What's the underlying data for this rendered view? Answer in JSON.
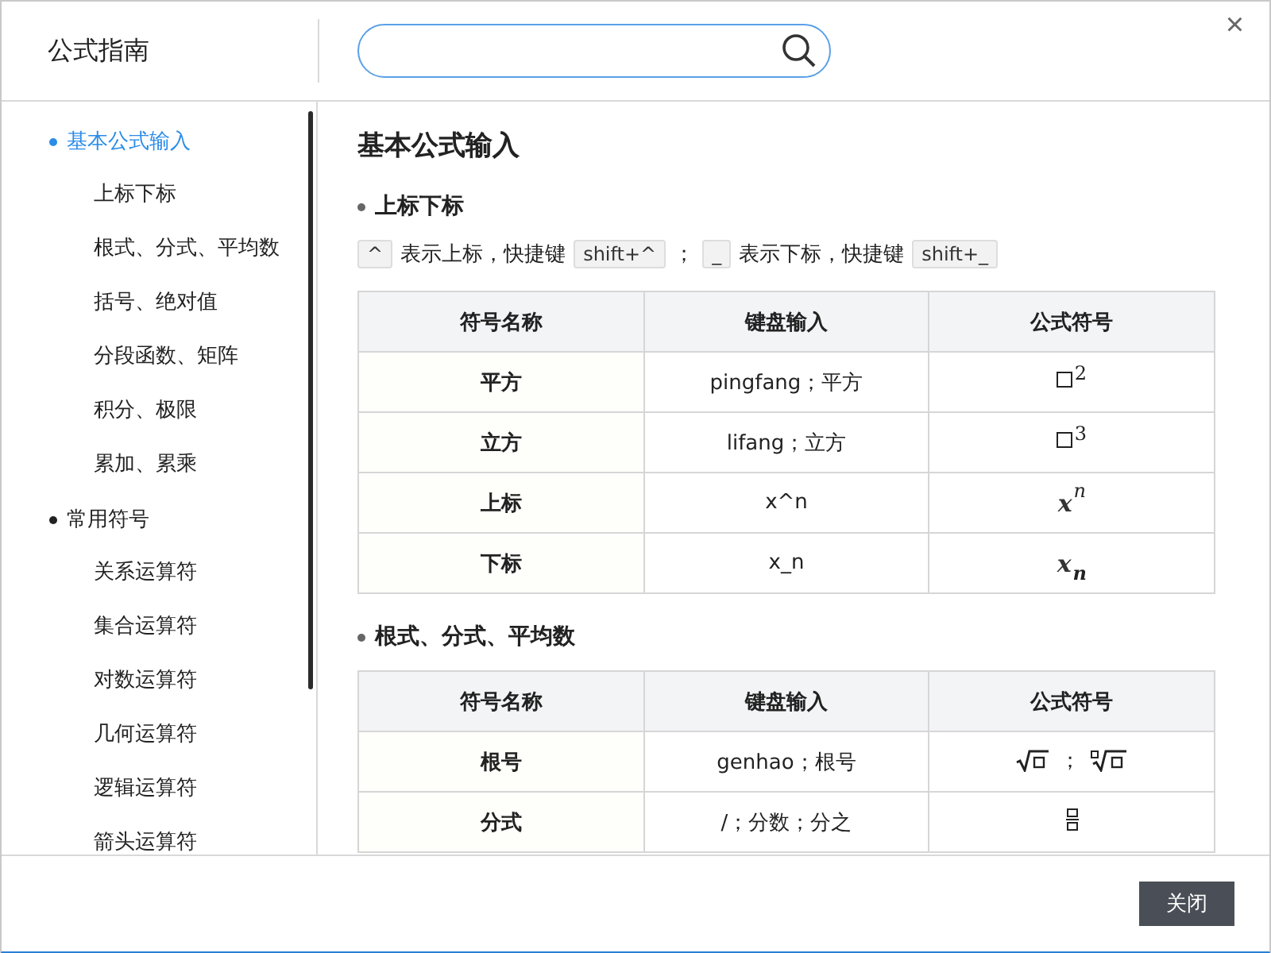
{
  "window": {
    "title": "公式指南",
    "close": "×"
  },
  "sidebar": {
    "items": [
      {
        "label": "基本公式输入",
        "selected": true,
        "children": [
          {
            "label": "上标下标",
            "selected": false
          },
          {
            "label": "根式、分式、平均数",
            "selected": false
          },
          {
            "label": "括号、绝对值",
            "selected": false
          },
          {
            "label": "分段函数、矩阵",
            "selected": false
          },
          {
            "label": "积分、极限",
            "selected": false
          },
          {
            "label": "累加、累乘",
            "selected": false
          }
        ]
      },
      {
        "label": "常用符号",
        "selected": false,
        "children": [
          {
            "label": "关系运算符",
            "selected": false
          },
          {
            "label": "集合运算符",
            "selected": false
          },
          {
            "label": "对数运算符",
            "selected": false
          },
          {
            "label": "几何运算符",
            "selected": false
          },
          {
            "label": "逻辑运算符",
            "selected": false
          },
          {
            "label": "箭头运算符",
            "selected": false
          }
        ]
      }
    ]
  },
  "content": {
    "title": "基本公式输入",
    "sections": [
      {
        "heading": "上标下标",
        "hint": [
          {
            "kind": "key",
            "text": "^"
          },
          {
            "kind": "text",
            "text": "表示上标，快捷键"
          },
          {
            "kind": "key",
            "text": "shift+^"
          },
          {
            "kind": "text",
            "text": "；"
          },
          {
            "kind": "key",
            "text": "_"
          },
          {
            "kind": "text",
            "text": "表示下标，快捷键"
          },
          {
            "kind": "key",
            "text": "shift+_"
          }
        ],
        "table": {
          "columns": [
            "符号名称",
            "键盘输入",
            "公式符号"
          ],
          "rows": [
            {
              "name": "平方",
              "input": "pingfang；平方",
              "formula": {
                "kind": "box-sup",
                "script": "2"
              }
            },
            {
              "name": "立方",
              "input": "lifang；立方",
              "formula": {
                "kind": "box-sup",
                "script": "3"
              }
            },
            {
              "name": "上标",
              "input": "x^n",
              "formula": {
                "kind": "var-sup",
                "base": "x",
                "script": "n"
              }
            },
            {
              "name": "下标",
              "input": "x_n",
              "formula": {
                "kind": "var-sub",
                "base": "x",
                "script": "n"
              }
            }
          ]
        }
      },
      {
        "heading": "根式、分式、平均数",
        "table": {
          "columns": [
            "符号名称",
            "键盘输入",
            "公式符号"
          ],
          "rows": [
            {
              "name": "根号",
              "input": "genhao；根号",
              "formula": {
                "kind": "roots",
                "separator": "；"
              }
            },
            {
              "name": "分式",
              "input": "/；分数；分之",
              "formula": {
                "kind": "fraction"
              }
            }
          ]
        }
      }
    ]
  },
  "footer": {
    "button": "关闭"
  }
}
